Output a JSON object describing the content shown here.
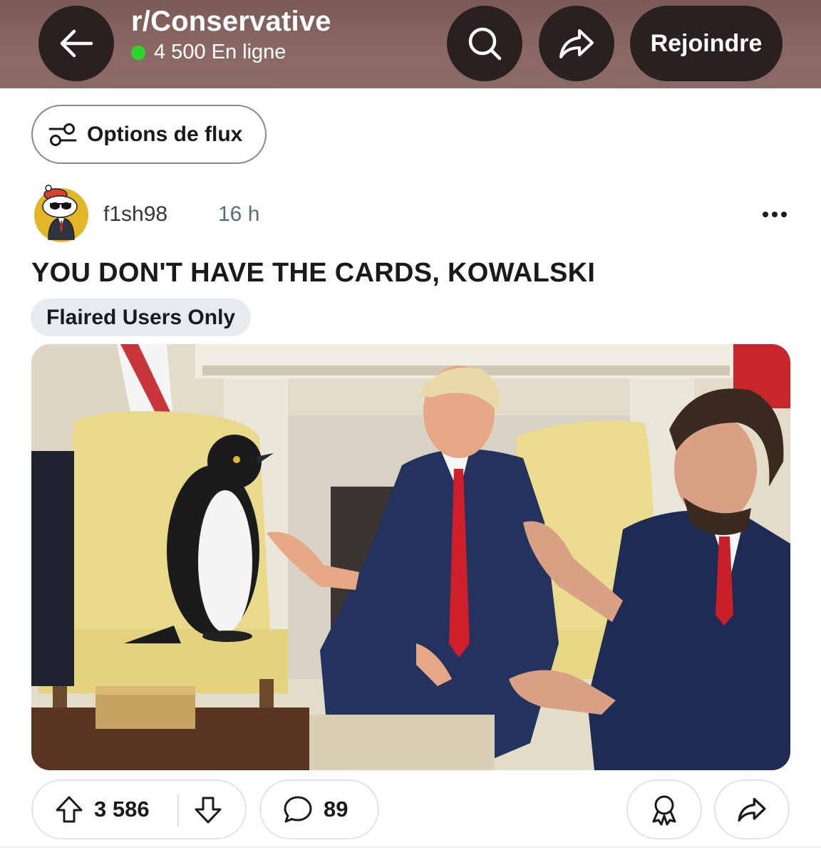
{
  "header": {
    "subreddit": "r/Conservative",
    "online": "4 500 En ligne",
    "join_label": "Rejoindre",
    "icons": [
      "back-arrow-icon",
      "search-icon",
      "share-icon"
    ],
    "colors": {
      "background": "#8b6864",
      "button": "#2a201f",
      "online_dot": "#2bd62b"
    }
  },
  "feed_options": {
    "label": "Options de flux",
    "icon": "sliders-icon"
  },
  "post": {
    "author": "f1sh98",
    "time": "16 h",
    "title": "YOU DON'T HAVE THE CARDS, KOWALSKI",
    "flair": "Flaired Users Only",
    "image_icon": "post-image",
    "upvotes": "3 586",
    "comments": "89",
    "icons": [
      "upvote-icon",
      "downvote-icon",
      "comment-icon",
      "award-icon",
      "share-icon",
      "more-options-icon"
    ]
  }
}
